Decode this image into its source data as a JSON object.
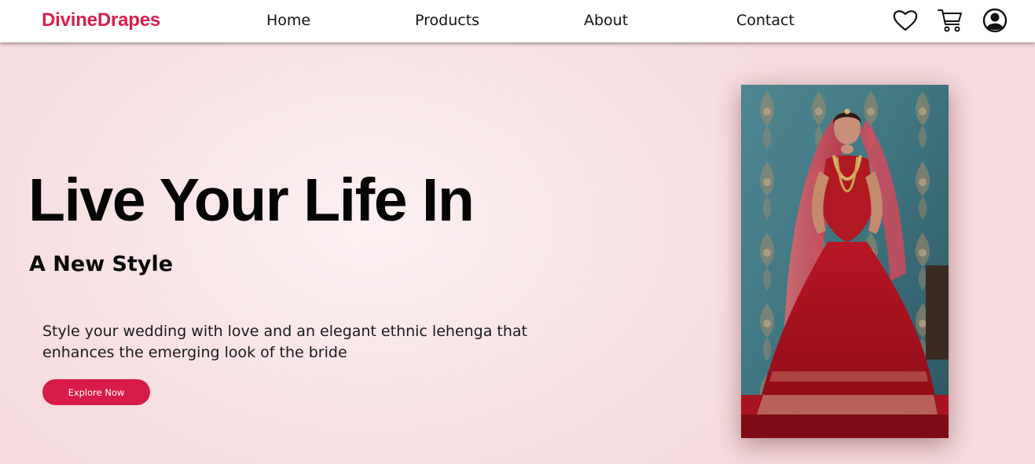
{
  "brand": {
    "name": "DivineDrapes",
    "color": "#d6204d"
  },
  "nav": {
    "links": [
      {
        "label": "Home"
      },
      {
        "label": "Products"
      },
      {
        "label": "About"
      },
      {
        "label": "Contact"
      }
    ],
    "icons": [
      "heart-icon",
      "cart-icon",
      "user-icon"
    ]
  },
  "hero": {
    "headline": "Live Your Life In",
    "subheadline": "A New Style",
    "description": "Style your wedding with love and an elegant ethnic lehenga that enhances the emerging look of the bride",
    "cta_label": "Explore Now",
    "cta_color": "#d81b48",
    "image": "bride-in-red-lehenga"
  }
}
